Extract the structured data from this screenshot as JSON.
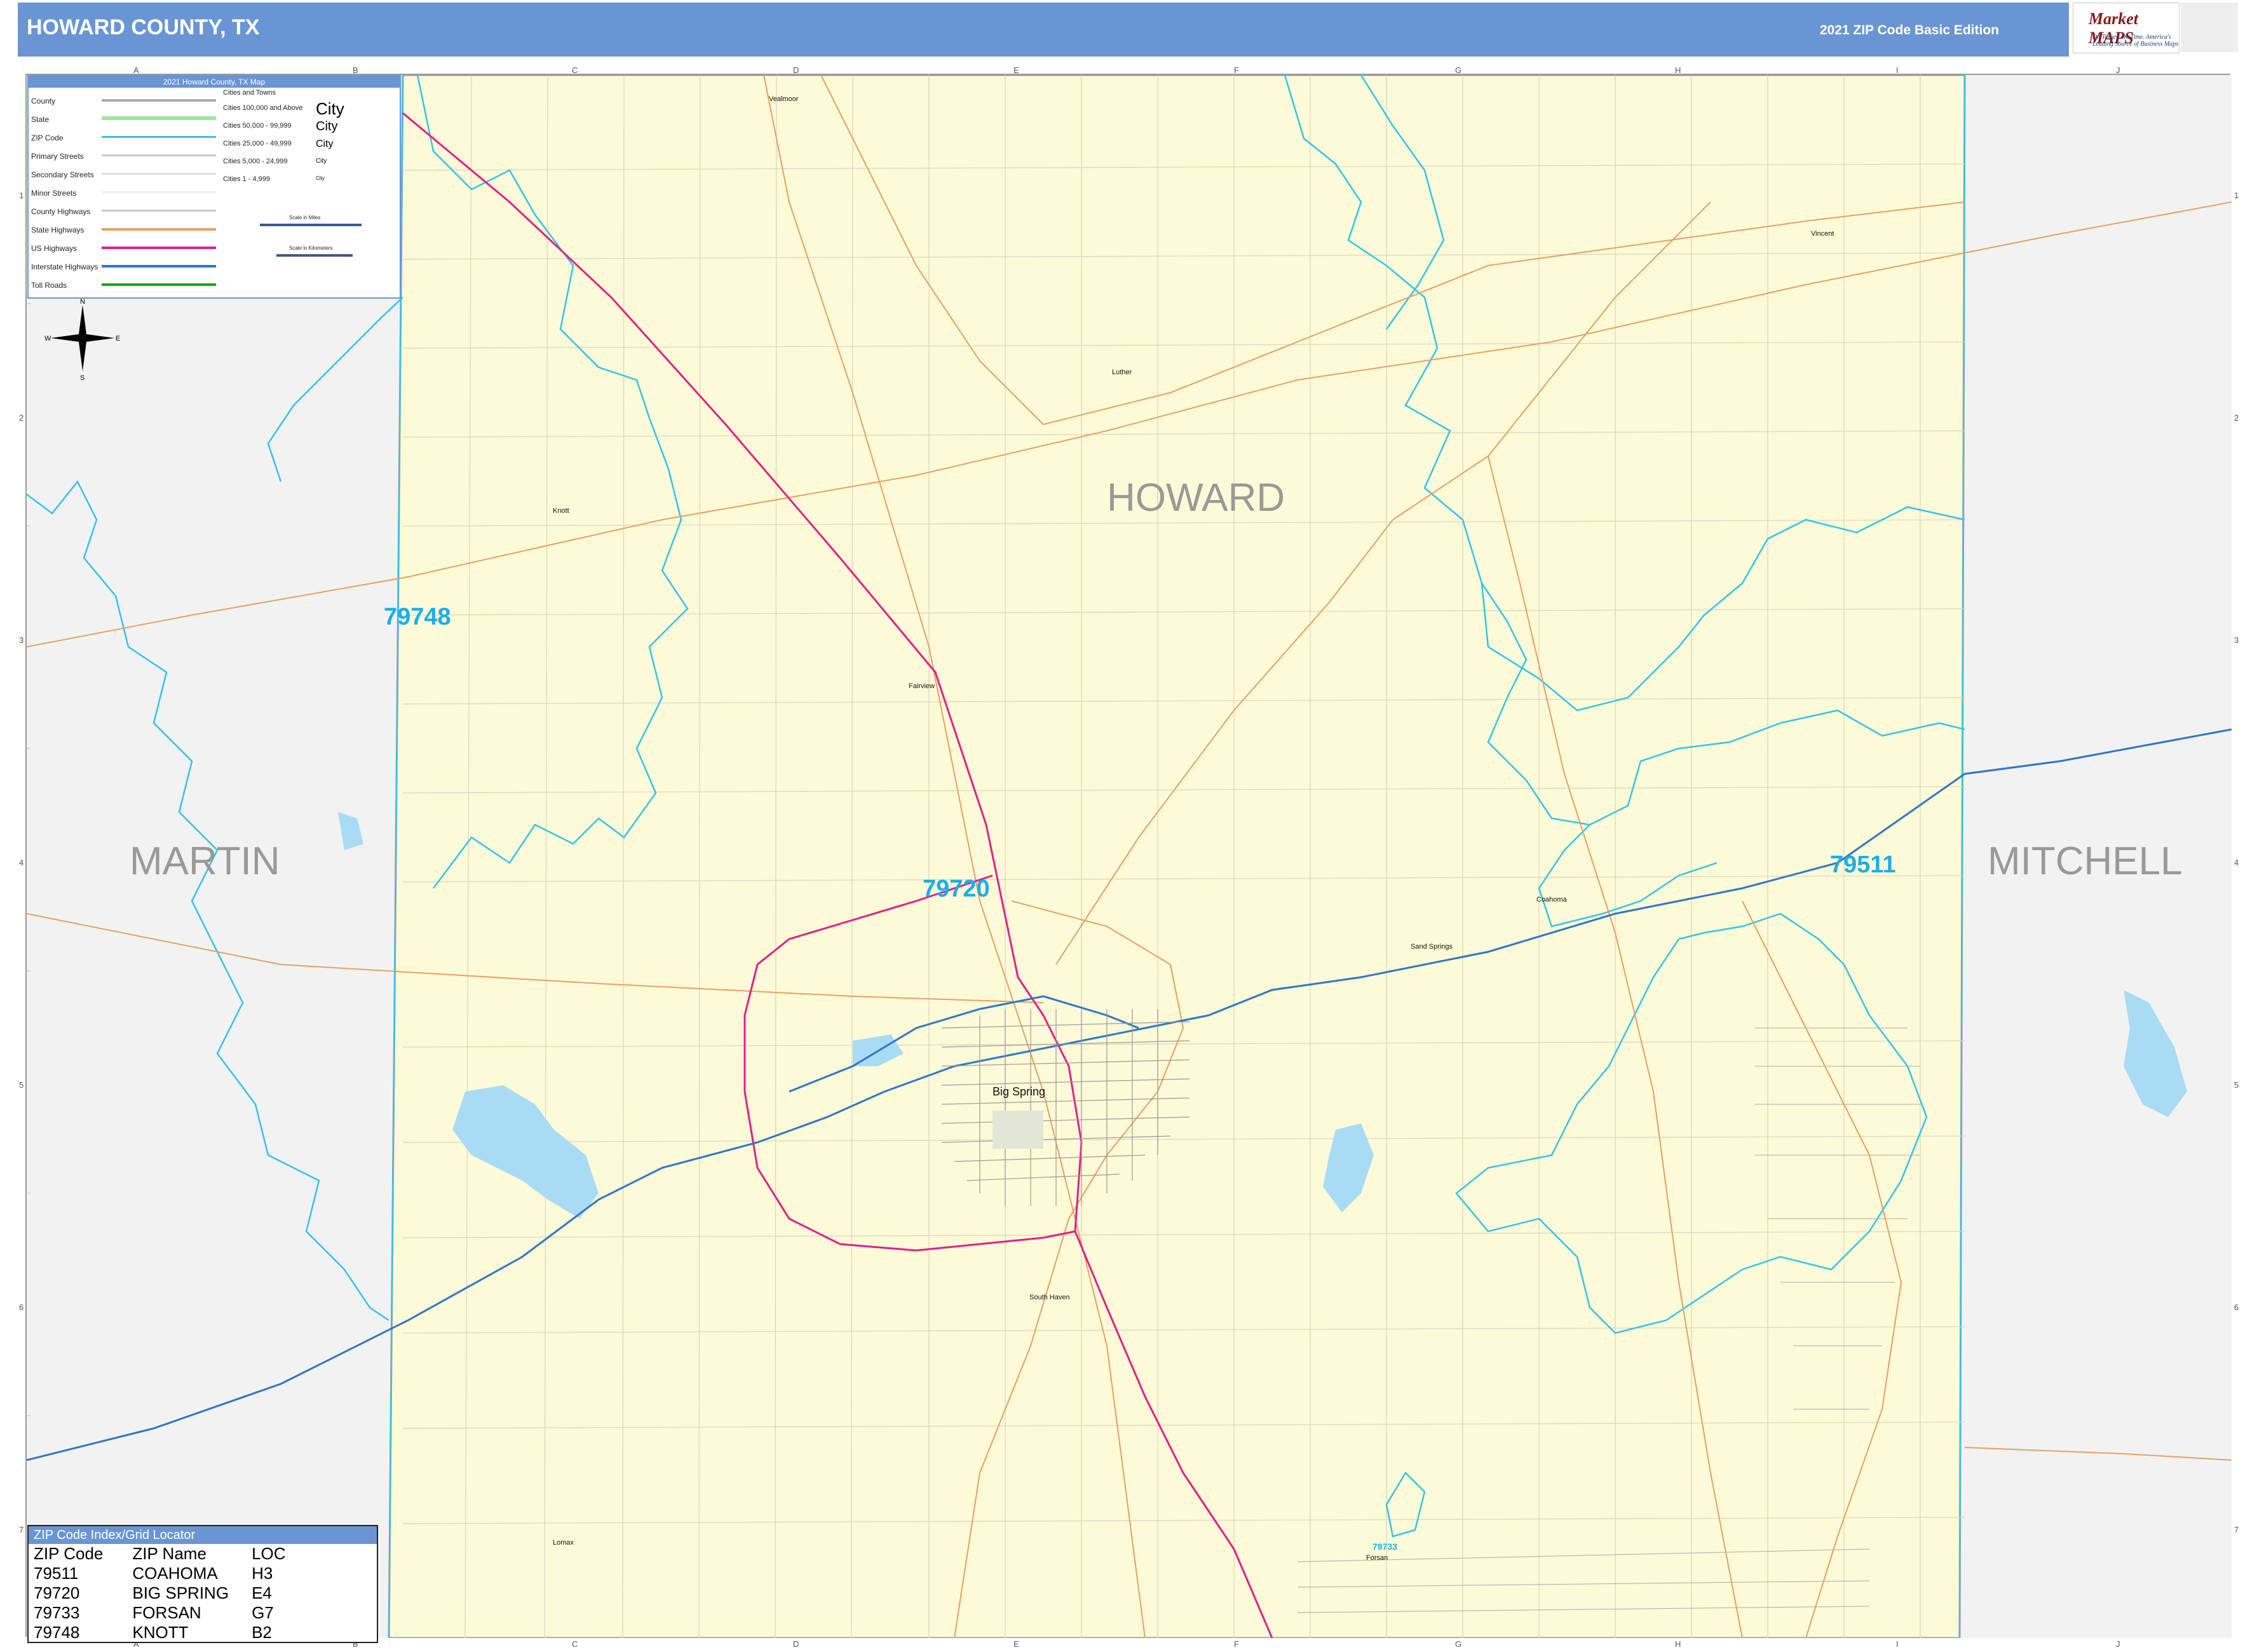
{
  "header": {
    "title": "HOWARD COUNTY, TX",
    "edition": "2021 ZIP Code Basic Edition"
  },
  "logo": {
    "brand": "Market MAPS",
    "tagline": "On Target. On Time. America's Leading Source of Business Maps"
  },
  "legend": {
    "title": "2021 Howard County, TX Map",
    "items": [
      "County",
      "State",
      "ZIP Code",
      "Primary Streets",
      "Secondary Streets",
      "Minor Streets",
      "County Highways",
      "State Highways",
      "US Highways",
      "Interstate Highways",
      "Toll Roads"
    ],
    "colors": [
      "#aaaaaa",
      "#9de89d",
      "#33c3ee",
      "#cccccc",
      "#dddddd",
      "#eeeeee",
      "#c8c8c8",
      "#e8a060",
      "#e0208a",
      "#2f76c8",
      "#18a018"
    ],
    "cities_title": "Cities and Towns",
    "city_classes": [
      "Cities 100,000 and Above",
      "Cities 50,000 - 99,999",
      "Cities 25,000 - 49,999",
      "Cities 5,000 - 24,999",
      "Cities 1 - 4,999"
    ],
    "city_marks": [
      "City",
      "City",
      "City",
      "City",
      "City"
    ],
    "scale_miles": "Scale in Miles",
    "scale_km": "Scale in Kilometers"
  },
  "compass": {
    "n": "N",
    "s": "S",
    "e": "E",
    "w": "W"
  },
  "grid": {
    "cols": [
      "A",
      "B",
      "C",
      "D",
      "E",
      "F",
      "G",
      "H",
      "I",
      "J"
    ],
    "rows": [
      "1",
      "2",
      "3",
      "4",
      "5",
      "6",
      "7"
    ]
  },
  "counties": {
    "center": "HOWARD",
    "west": "MARTIN",
    "east": "MITCHELL"
  },
  "zip_labels": {
    "z79748": "79748",
    "z79720": "79720",
    "z79511": "79511",
    "z79733": "79733"
  },
  "places": {
    "big_spring": "Big Spring",
    "coahoma": "Coahoma",
    "forsan": "Forsan",
    "knott": "Knott",
    "luther": "Luther",
    "vealmoor": "Vealmoor",
    "vincent": "Vincent",
    "fairview": "Fairview",
    "sand_springs": "Sand Springs",
    "lomax": "Lomax",
    "south_haven": "South Haven"
  },
  "zip_index": {
    "title": "ZIP Code Index/Grid Locator",
    "headers": [
      "ZIP Code",
      "ZIP Name",
      "LOC"
    ],
    "rows": [
      [
        "79511",
        "COAHOMA",
        "H3"
      ],
      [
        "79720",
        "BIG SPRING",
        "E4"
      ],
      [
        "79733",
        "FORSAN",
        "G7"
      ],
      [
        "79748",
        "KNOTT",
        "B2"
      ]
    ]
  },
  "colors": {
    "header": "#6a95d4",
    "county_fill": "#fdfad7",
    "outside": "#f2f2f2",
    "zip_boundary": "#33c3ee",
    "interstate": "#2f76c8",
    "us_highway": "#e0208a",
    "state_highway": "#e8a060",
    "water": "#a8dcf5",
    "zip_label": "#1aaeeb"
  }
}
